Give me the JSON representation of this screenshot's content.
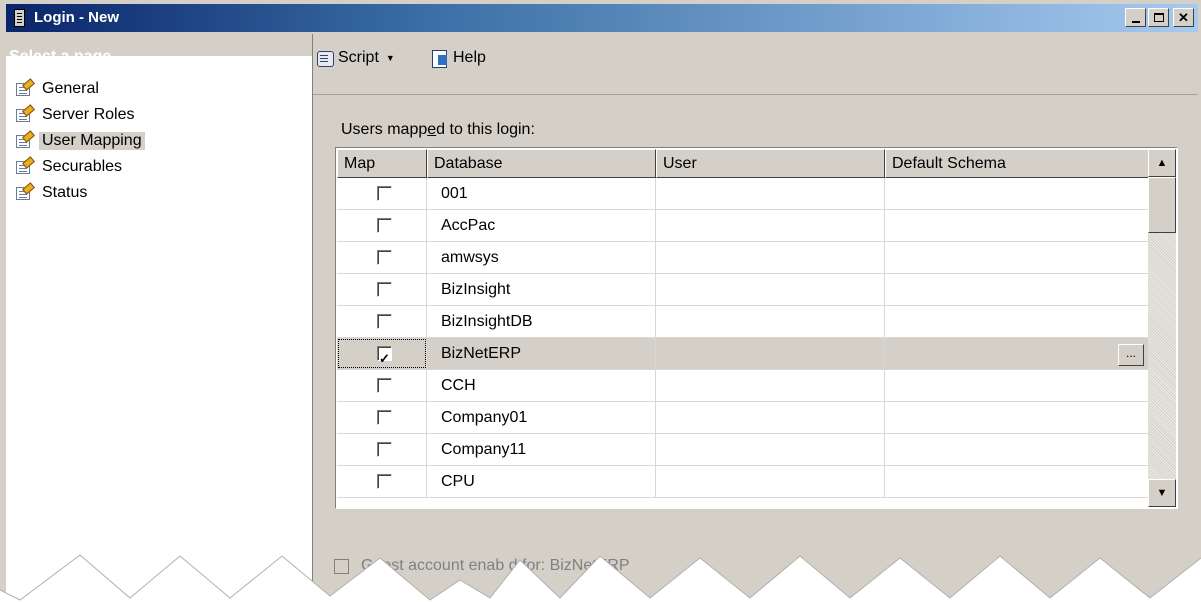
{
  "window": {
    "title": "Login - New"
  },
  "left_pane": {
    "header": "Select a page",
    "items": [
      {
        "label": "General",
        "selected": false
      },
      {
        "label": "Server Roles",
        "selected": false
      },
      {
        "label": "User Mapping",
        "selected": true
      },
      {
        "label": "Securables",
        "selected": false
      },
      {
        "label": "Status",
        "selected": false
      }
    ]
  },
  "toolbar": {
    "script_label": "Script",
    "help_label": "Help"
  },
  "content": {
    "grid_label_prefix": "Users mapp",
    "grid_label_accel": "e",
    "grid_label_suffix": "d to this login:",
    "columns": [
      "Map",
      "Database",
      "User",
      "Default Schema"
    ],
    "rows": [
      {
        "map": false,
        "database": "001",
        "user": "",
        "schema": ""
      },
      {
        "map": false,
        "database": "AccPac",
        "user": "",
        "schema": ""
      },
      {
        "map": false,
        "database": "amwsys",
        "user": "",
        "schema": ""
      },
      {
        "map": false,
        "database": "BizInsight",
        "user": "",
        "schema": ""
      },
      {
        "map": false,
        "database": "BizInsightDB",
        "user": "",
        "schema": ""
      },
      {
        "map": true,
        "database": "BizNetERP",
        "user": "",
        "schema": "",
        "selected": true,
        "ellipsis": "..."
      },
      {
        "map": false,
        "database": "CCH",
        "user": "",
        "schema": ""
      },
      {
        "map": false,
        "database": "Company01",
        "user": "",
        "schema": ""
      },
      {
        "map": false,
        "database": "Company11",
        "user": "",
        "schema": ""
      },
      {
        "map": false,
        "database": "CPU",
        "user": "",
        "schema": ""
      }
    ],
    "guest_label": "Guest account enab  d for: BizNetERP",
    "guest_enabled": false
  },
  "colors": {
    "title_start": "#0a246a",
    "title_end": "#a6caf0",
    "face": "#d4d0c8"
  }
}
